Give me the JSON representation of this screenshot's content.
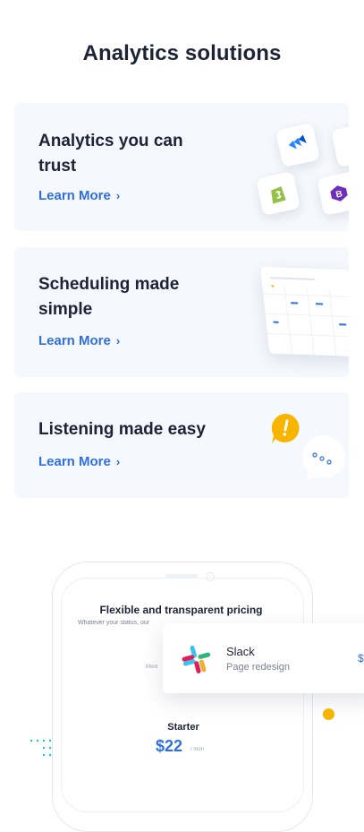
{
  "section": {
    "title": "Analytics solutions"
  },
  "cards": [
    {
      "title": "Analytics you can trust",
      "link": "Learn More"
    },
    {
      "title": "Scheduling made simple",
      "link": "Learn More"
    },
    {
      "title": "Listening made easy",
      "link": "Learn More"
    }
  ],
  "phone": {
    "pricing_title": "Flexible and transparent pricing",
    "pricing_subtitle": "Whatever your status, our",
    "toggle_label": "Mont",
    "plan_name": "Starter",
    "plan_price": "$22",
    "plan_period": "/ mon"
  },
  "notification": {
    "title": "Slack",
    "subtitle": "Page redesign",
    "price": "$"
  },
  "icons": [
    "jira-icon",
    "shopify-icon",
    "bootstrap-icon",
    "calendar-illustration",
    "exclamation-bubble-icon",
    "chat-bubble-icon",
    "slack-icon",
    "chevron-right-icon"
  ],
  "colors": {
    "accent": "#2f6fe4",
    "card_bg": "#f5f8fd",
    "yellow": "#f7b500",
    "heading": "#1e2235"
  }
}
